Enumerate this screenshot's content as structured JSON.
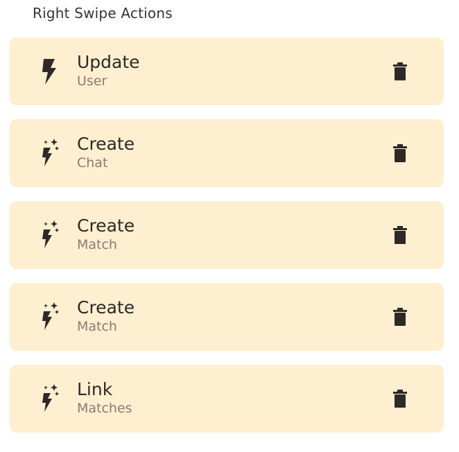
{
  "section": {
    "title": "Right Swipe Actions"
  },
  "actions": [
    {
      "label": "Update",
      "subtitle": "User",
      "icon": "bolt-icon"
    },
    {
      "label": "Create",
      "subtitle": "Chat",
      "icon": "bolt-sparkle-icon"
    },
    {
      "label": "Create",
      "subtitle": "Match",
      "icon": "bolt-sparkle-icon"
    },
    {
      "label": "Create",
      "subtitle": "Match",
      "icon": "bolt-sparkle-icon"
    },
    {
      "label": "Link",
      "subtitle": "Matches",
      "icon": "bolt-sparkle-icon"
    }
  ],
  "delete_icon": "trash-icon",
  "colors": {
    "card_background": "#feefd0",
    "text_primary": "#2e2927",
    "text_secondary": "#8a7b72",
    "icon": "#2e2927"
  }
}
